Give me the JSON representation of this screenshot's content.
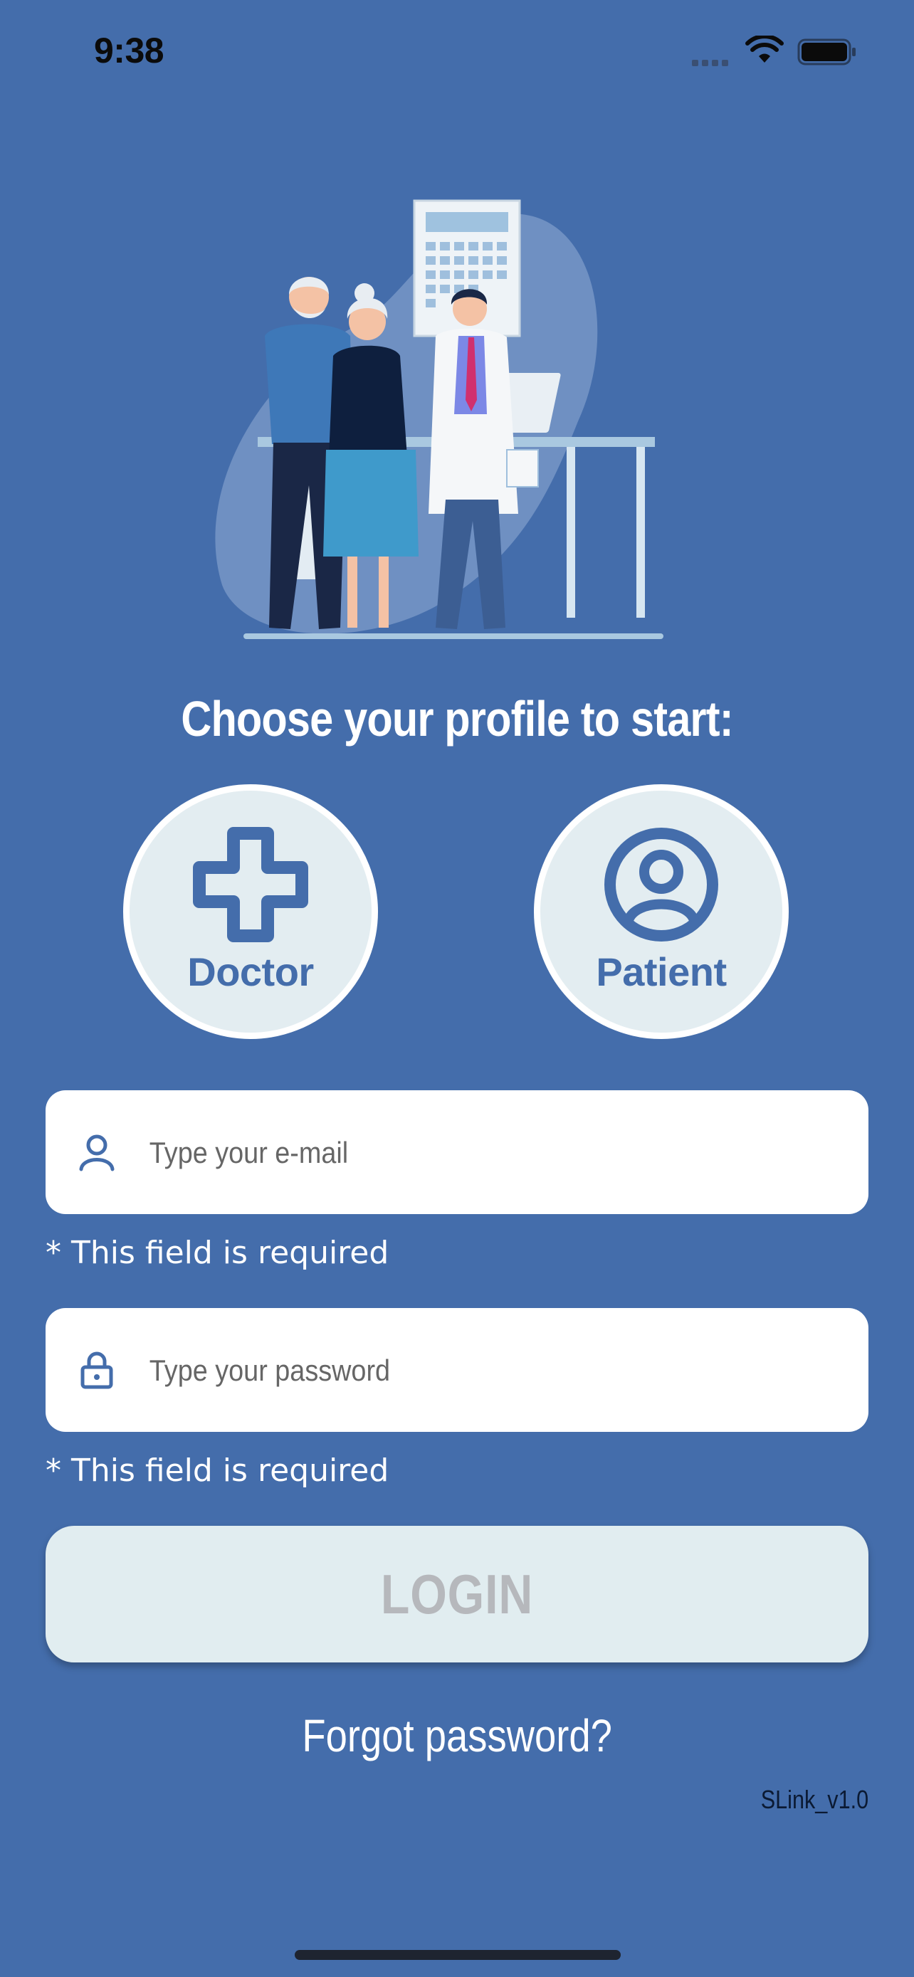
{
  "status_bar": {
    "time": "9:38"
  },
  "headline": "Choose your profile to start:",
  "profiles": [
    {
      "label": "Doctor",
      "icon": "medical-cross-icon"
    },
    {
      "label": "Patient",
      "icon": "user-circle-icon"
    }
  ],
  "email_field": {
    "placeholder": "Type your e-mail",
    "value": "",
    "icon": "user-icon",
    "error": "* This field is required"
  },
  "password_field": {
    "placeholder": "Type your password",
    "value": "",
    "icon": "lock-icon",
    "error": "* This field is required"
  },
  "login_label": "LOGIN",
  "forgot_label": "Forgot password?",
  "version": "SLink_v1.0",
  "colors": {
    "background": "#446DAB",
    "accent": "#446DAB",
    "button_bg": "#E1EDF0",
    "button_text": "#B6B8BC"
  }
}
